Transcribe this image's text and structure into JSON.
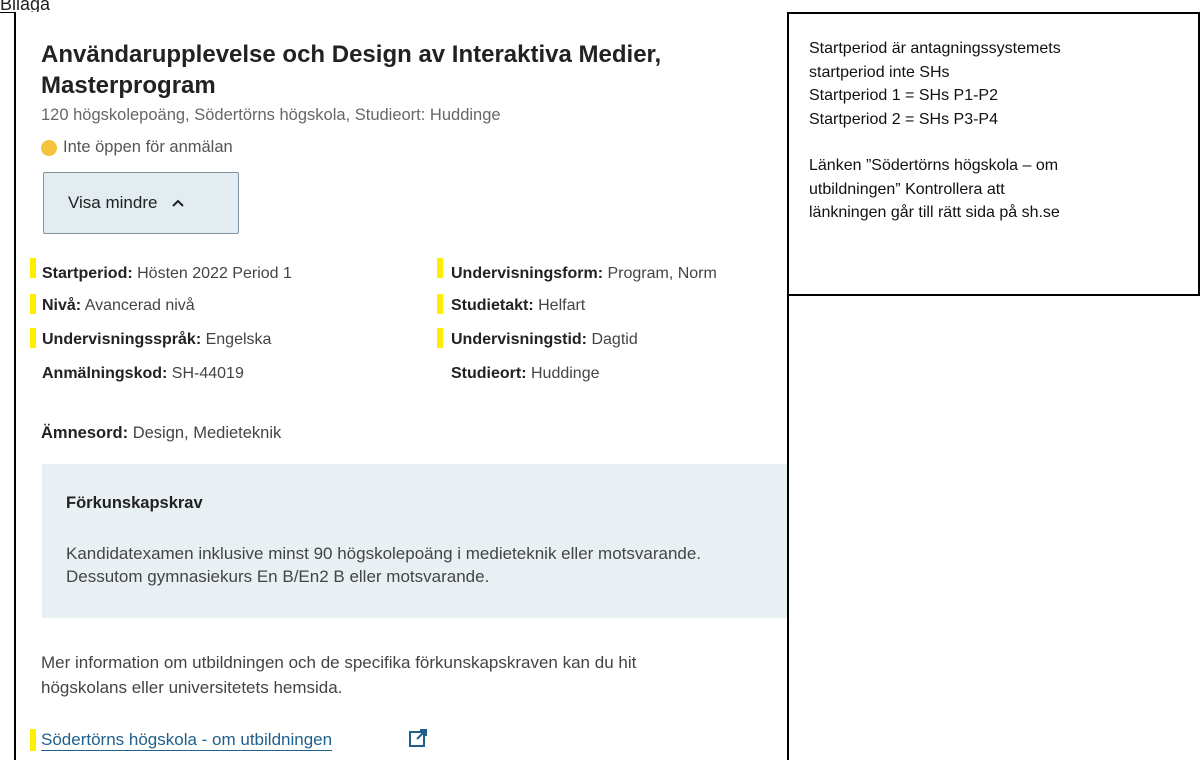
{
  "document": {
    "top_label": "Bilaga"
  },
  "program": {
    "title": "Användarupplevelse och Design av Interaktiva Medier, Masterprogram",
    "subtitle": "120 högskolepoäng, Södertörns högskola, Studieort: Huddinge",
    "status": "Inte öppen för anmälan",
    "status_color": "#f3c33b",
    "toggle_label": "Visa mindre"
  },
  "facts": {
    "startperiod": {
      "label": "Startperiod:",
      "value": "Hösten 2022 Period 1"
    },
    "niva": {
      "label": "Nivå:",
      "value": "Avancerad nivå"
    },
    "sprak": {
      "label": "Undervisningsspråk:",
      "value": "Engelska"
    },
    "anmkod": {
      "label": "Anmälningskod:",
      "value": "SH-44019"
    },
    "form": {
      "label": "Undervisningsform:",
      "value": "Program, Norm"
    },
    "takt": {
      "label": "Studietakt:",
      "value": "Helfart"
    },
    "tid": {
      "label": "Undervisningstid:",
      "value": "Dagtid"
    },
    "ort": {
      "label": "Studieort:",
      "value": "Huddinge"
    },
    "amnesord": {
      "label": "Ämnesord:",
      "value": "Design, Medieteknik"
    }
  },
  "prerequisites": {
    "title": "Förkunskapskrav",
    "text": "Kandidatexamen inklusive minst 90 högskolepoäng i medieteknik eller motsvarande. Dessutom gymnasiekurs En B/En2 B eller motsvarande."
  },
  "more_info": "Mer information om utbildningen och de specifika förkunskapskraven kan du hit\nhögskolans eller universitetets hemsida.",
  "external_link": "Södertörns högskola - om utbildningen",
  "highlight_color": "#ffee00",
  "note": {
    "line1": "Startperiod är antagningssystemets",
    "line2": "startperiod inte SHs",
    "line3": "Startperiod 1 = SHs  P1-P2",
    "line4": "Startperiod 2 = SHs  P3-P4",
    "line5": "Länken ”Södertörns högskola – om",
    "line6": "utbildningen” Kontrollera att",
    "line7": "länkningen går till rätt sida på sh.se"
  }
}
